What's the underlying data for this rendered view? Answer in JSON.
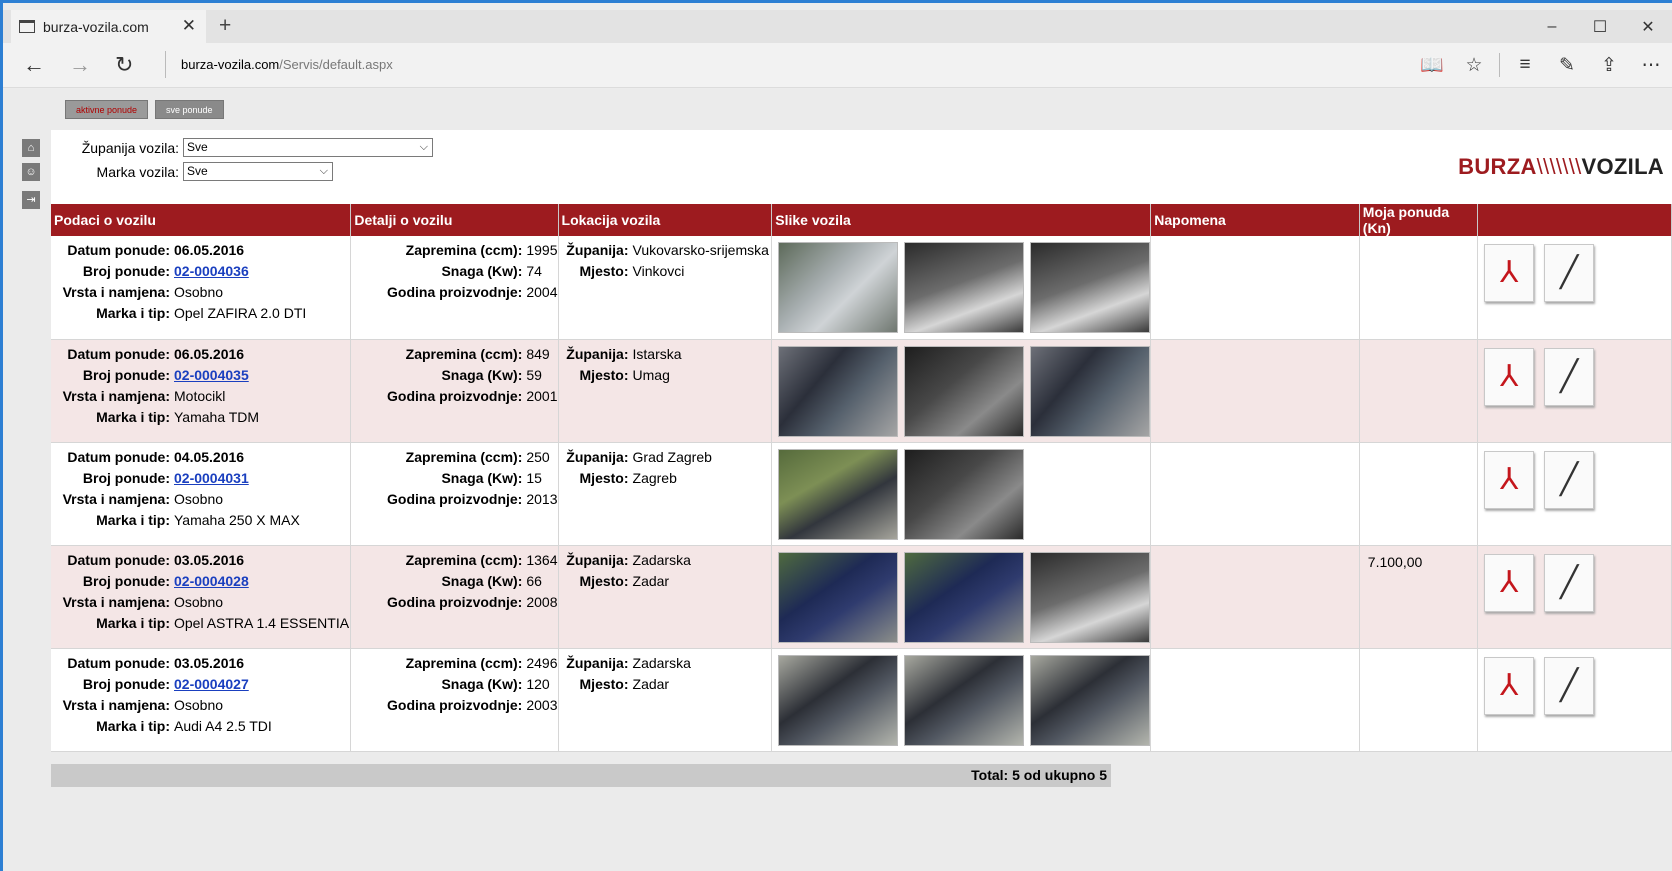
{
  "browser": {
    "tab_title": "burza-vozila.com",
    "url_host": "burza-vozila.com",
    "url_path": "/Servis/default.aspx",
    "win_minimize": "–",
    "win_maximize": "☐",
    "win_close": "✕"
  },
  "top_buttons": {
    "aktivne": "aktivne ponude",
    "sve": "sve ponude"
  },
  "filters": {
    "zupanija_label": "Županija vozila:",
    "zupanija_value": "Sve",
    "marka_label": "Marka vozila:",
    "marka_value": "Sve"
  },
  "logo": {
    "burza": "BURZA",
    "slashes": "\\\\\\\\\\\\\\",
    "vozila": "VOZILA"
  },
  "table": {
    "headers": [
      "Podaci o vozilu",
      "Detalji o vozilu",
      "Lokacija vozila",
      "Slike vozila",
      "Napomena",
      "Moja ponuda (Kn)",
      ""
    ],
    "labels": {
      "datum": "Datum ponude:",
      "broj": "Broj ponude:",
      "vrsta": "Vrsta i namjena:",
      "marka": "Marka i tip:",
      "zapremina": "Zapremina (ccm):",
      "snaga": "Snaga (Kw):",
      "godina": "Godina proizvodnje:",
      "zupanija": "Županija:",
      "mjesto": "Mjesto:"
    },
    "rows": [
      {
        "datum": "06.05.2016",
        "broj": "02-0004036",
        "vrsta": "Osobno",
        "marka": "Opel ZAFIRA 2.0 DTI",
        "zapremina": "1995",
        "snaga": "74",
        "godina": "2004",
        "zupanija": "Vukovarsko-srijemska",
        "mjesto": "Vinkovci",
        "napomena": "",
        "moja_ponuda": ""
      },
      {
        "datum": "06.05.2016",
        "broj": "02-0004035",
        "vrsta": "Motocikl",
        "marka": "Yamaha TDM",
        "zapremina": "849",
        "snaga": "59",
        "godina": "2001",
        "zupanija": "Istarska",
        "mjesto": "Umag",
        "napomena": "",
        "moja_ponuda": ""
      },
      {
        "datum": "04.05.2016",
        "broj": "02-0004031",
        "vrsta": "Osobno",
        "marka": "Yamaha 250 X MAX",
        "zapremina": "250",
        "snaga": "15",
        "godina": "2013",
        "zupanija": "Grad Zagreb",
        "mjesto": "Zagreb",
        "napomena": "",
        "moja_ponuda": ""
      },
      {
        "datum": "03.05.2016",
        "broj": "02-0004028",
        "vrsta": "Osobno",
        "marka": "Opel ASTRA 1.4 ESSENTIA",
        "zapremina": "1364",
        "snaga": "66",
        "godina": "2008",
        "zupanija": "Zadarska",
        "mjesto": "Zadar",
        "napomena": "",
        "moja_ponuda": "7.100,00"
      },
      {
        "datum": "03.05.2016",
        "broj": "02-0004027",
        "vrsta": "Osobno",
        "marka": "Audi A4 2.5 TDI",
        "zapremina": "2496",
        "snaga": "120",
        "godina": "2003",
        "zupanija": "Zadarska",
        "mjesto": "Zadar",
        "napomena": "",
        "moja_ponuda": ""
      }
    ]
  },
  "totals": "Total: 5 od ukupno 5"
}
